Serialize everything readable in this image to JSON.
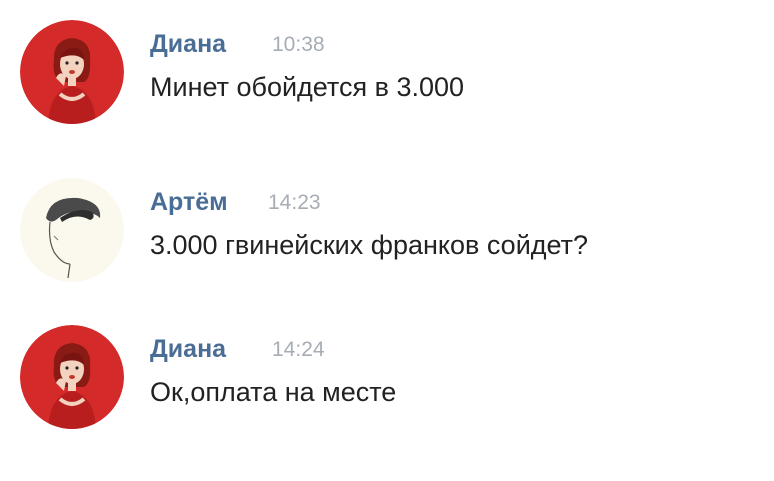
{
  "messages": [
    {
      "author": "Диана",
      "time": "10:38",
      "text": "Минет обойдется в 3.000",
      "avatar_icon": "woman-red-dress-avatar"
    },
    {
      "author": "Артём",
      "time": "14:23",
      "text": "3.000 гвинейских франков сойдет?",
      "avatar_icon": "man-sketch-avatar"
    },
    {
      "author": "Диана",
      "time": "14:24",
      "text": "Ок,оплата на месте",
      "avatar_icon": "woman-red-dress-avatar"
    }
  ],
  "colors": {
    "author_name": "#4a6d96",
    "timestamp": "#a7adb5",
    "message_text": "#222222",
    "avatar_red": "#d42a2a"
  }
}
